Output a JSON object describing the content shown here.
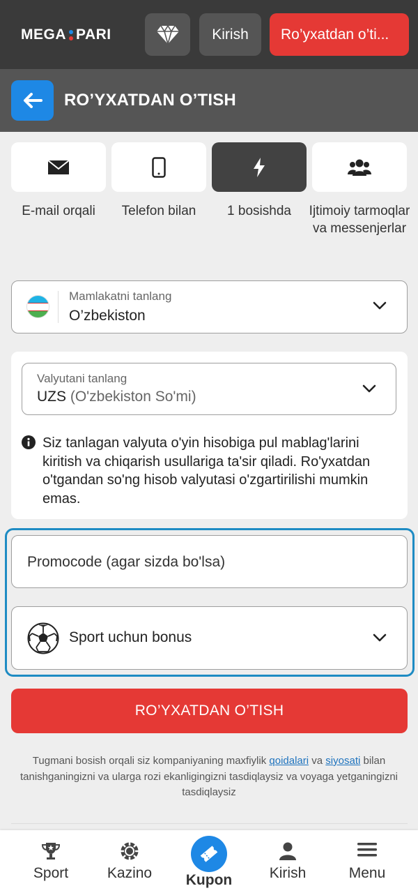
{
  "header": {
    "logo_left": "MEGA",
    "logo_right": "PARI",
    "login_label": "Kirish",
    "register_label": "Ro’yxatdan o’ti..."
  },
  "titlebar": {
    "title": "RO’YXATDAN O’TISH"
  },
  "tabs": [
    {
      "label": "E-mail orqali",
      "icon": "envelope-icon"
    },
    {
      "label": "Telefon bilan",
      "icon": "phone-icon"
    },
    {
      "label": "1 bosishda",
      "icon": "lightning-icon",
      "active": true
    },
    {
      "label": "Ijtimoiy tarmoqlar va messenjerlar",
      "icon": "users-icon"
    }
  ],
  "country": {
    "label": "Mamlakatni tanlang",
    "value": "O’zbekiston"
  },
  "currency": {
    "label": "Valyutani tanlang",
    "code": "UZS",
    "name": "(O'zbekiston So'mi)",
    "info": "Siz tanlagan valyuta o'yin hisobiga pul mablag'larini kiritish va chiqarish usullariga ta'sir qiladi. Ro'yxatdan o'tgandan so'ng hisob valyutasi o'zgartirilishi mumkin emas."
  },
  "promo": {
    "placeholder": "Promocode (agar sizda bo'lsa)"
  },
  "bonus": {
    "value": "Sport uchun bonus"
  },
  "submit_label": "RO’YXATDAN O’TISH",
  "terms": {
    "part1": "Tugmani bosish orqali siz kompaniyaning maxfiylik ",
    "link1": "qoidalari",
    "part2": " va ",
    "link2": "siyosati",
    "part3": " bilan tanishganingizni va ularga rozi ekanligingizni tasdiqlaysiz va voyaga yetganingizni tasdiqlaysiz"
  },
  "bottom_nav": [
    {
      "label": "Sport"
    },
    {
      "label": "Kazino"
    },
    {
      "label": "Kupon"
    },
    {
      "label": "Kirish"
    },
    {
      "label": "Menu"
    }
  ],
  "colors": {
    "brand_red": "#e53935",
    "accent_blue": "#1e88e5",
    "highlight_border": "#1e8bc3",
    "header_dark": "#3a3a3a"
  }
}
